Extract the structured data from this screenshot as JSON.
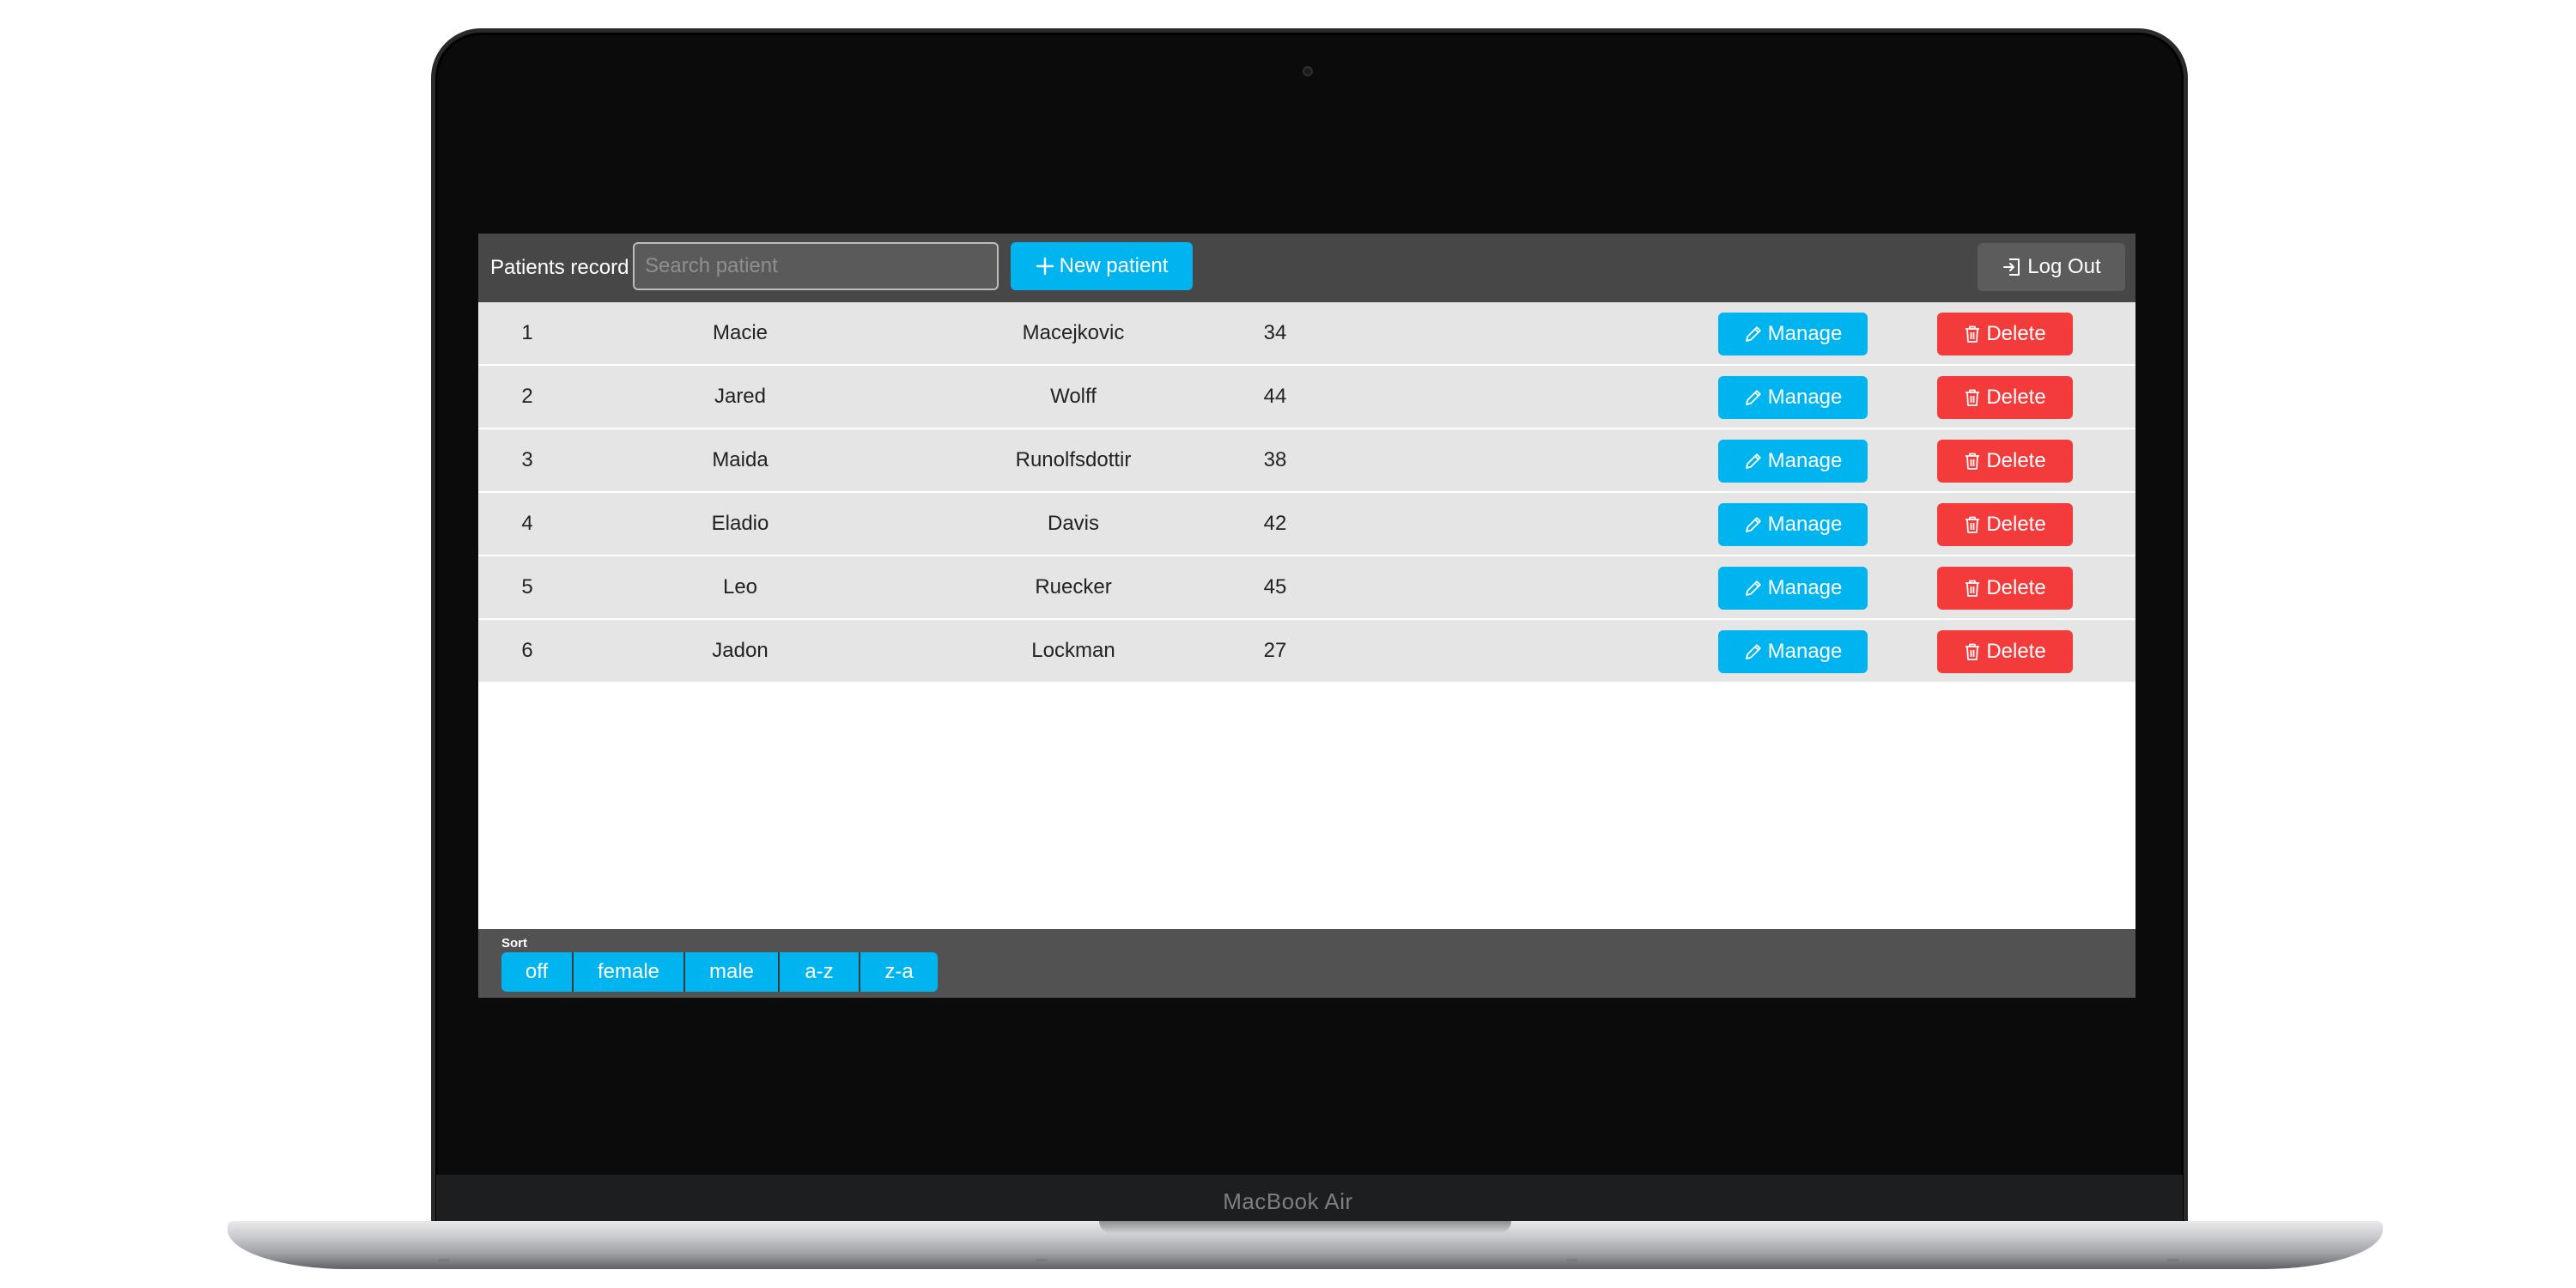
{
  "device": {
    "brand": "MacBook Air"
  },
  "header": {
    "title": "Patients record",
    "search_placeholder": "Search patient",
    "new_patient_label": "New patient",
    "logout_label": "Log Out"
  },
  "patients": [
    {
      "id": "1",
      "first_name": "Macie",
      "last_name": "Macejkovic",
      "age": "34"
    },
    {
      "id": "2",
      "first_name": "Jared",
      "last_name": "Wolff",
      "age": "44"
    },
    {
      "id": "3",
      "first_name": "Maida",
      "last_name": "Runolfsdottir",
      "age": "38"
    },
    {
      "id": "4",
      "first_name": "Eladio",
      "last_name": "Davis",
      "age": "42"
    },
    {
      "id": "5",
      "first_name": "Leo",
      "last_name": "Ruecker",
      "age": "45"
    },
    {
      "id": "6",
      "first_name": "Jadon",
      "last_name": "Lockman",
      "age": "27"
    }
  ],
  "row_actions": {
    "manage_label": "Manage",
    "delete_label": "Delete"
  },
  "sort": {
    "label": "Sort",
    "options": [
      "off",
      "female",
      "male",
      "a-z",
      "z-a"
    ]
  },
  "icons": {
    "new_patient": "plus-icon",
    "logout": "logout-icon",
    "manage": "pencil-icon",
    "delete": "trash-icon"
  },
  "colors": {
    "accent": "#00b4f0",
    "danger": "#f33b3b",
    "topbar": "#474747",
    "row_bg": "#e5e5e5"
  }
}
